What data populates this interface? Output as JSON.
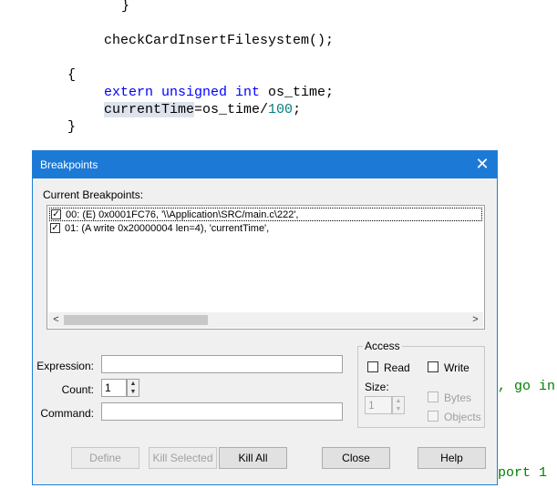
{
  "code": {
    "line1": "}",
    "line2": "checkCardInsertFilesystem();",
    "line3": "{",
    "line4_kw": "extern unsigned int",
    "line4_rest": " os_time;",
    "line5_var": "currentTime",
    "line5_mid": "=os_time/",
    "line5_num": "100",
    "line5_end": ";",
    "line6": "}",
    "frag1": ", go in",
    "frag2": "port 1"
  },
  "dialog": {
    "title": "Breakpoints",
    "close_glyph": "✕",
    "current_label": "Current Breakpoints:",
    "breakpoints": [
      {
        "text": "00: (E) 0x0001FC76,  '\\\\Application\\SRC/main.c\\222',",
        "checked": true
      },
      {
        "text": "01: (A write 0x20000004 len=4),  'currentTime',",
        "checked": true
      }
    ],
    "scroll_left": "<",
    "scroll_right": ">",
    "expression_label": "Expression:",
    "expression_value": "",
    "count_label": "Count:",
    "count_value": "1",
    "command_label": "Command:",
    "command_value": "",
    "access": {
      "label": "Access",
      "read": "Read",
      "write": "Write",
      "size_label": "Size:",
      "size_value": "1",
      "bytes": "Bytes",
      "objects": "Objects"
    },
    "buttons": {
      "define": "Define",
      "kill_selected": "Kill Selected",
      "kill_all": "Kill All",
      "close": "Close",
      "help": "Help"
    }
  },
  "colors": {
    "titlebar": "#1c7ad6",
    "keyword": "#0000ff",
    "number": "#008080",
    "comment": "#008000"
  }
}
